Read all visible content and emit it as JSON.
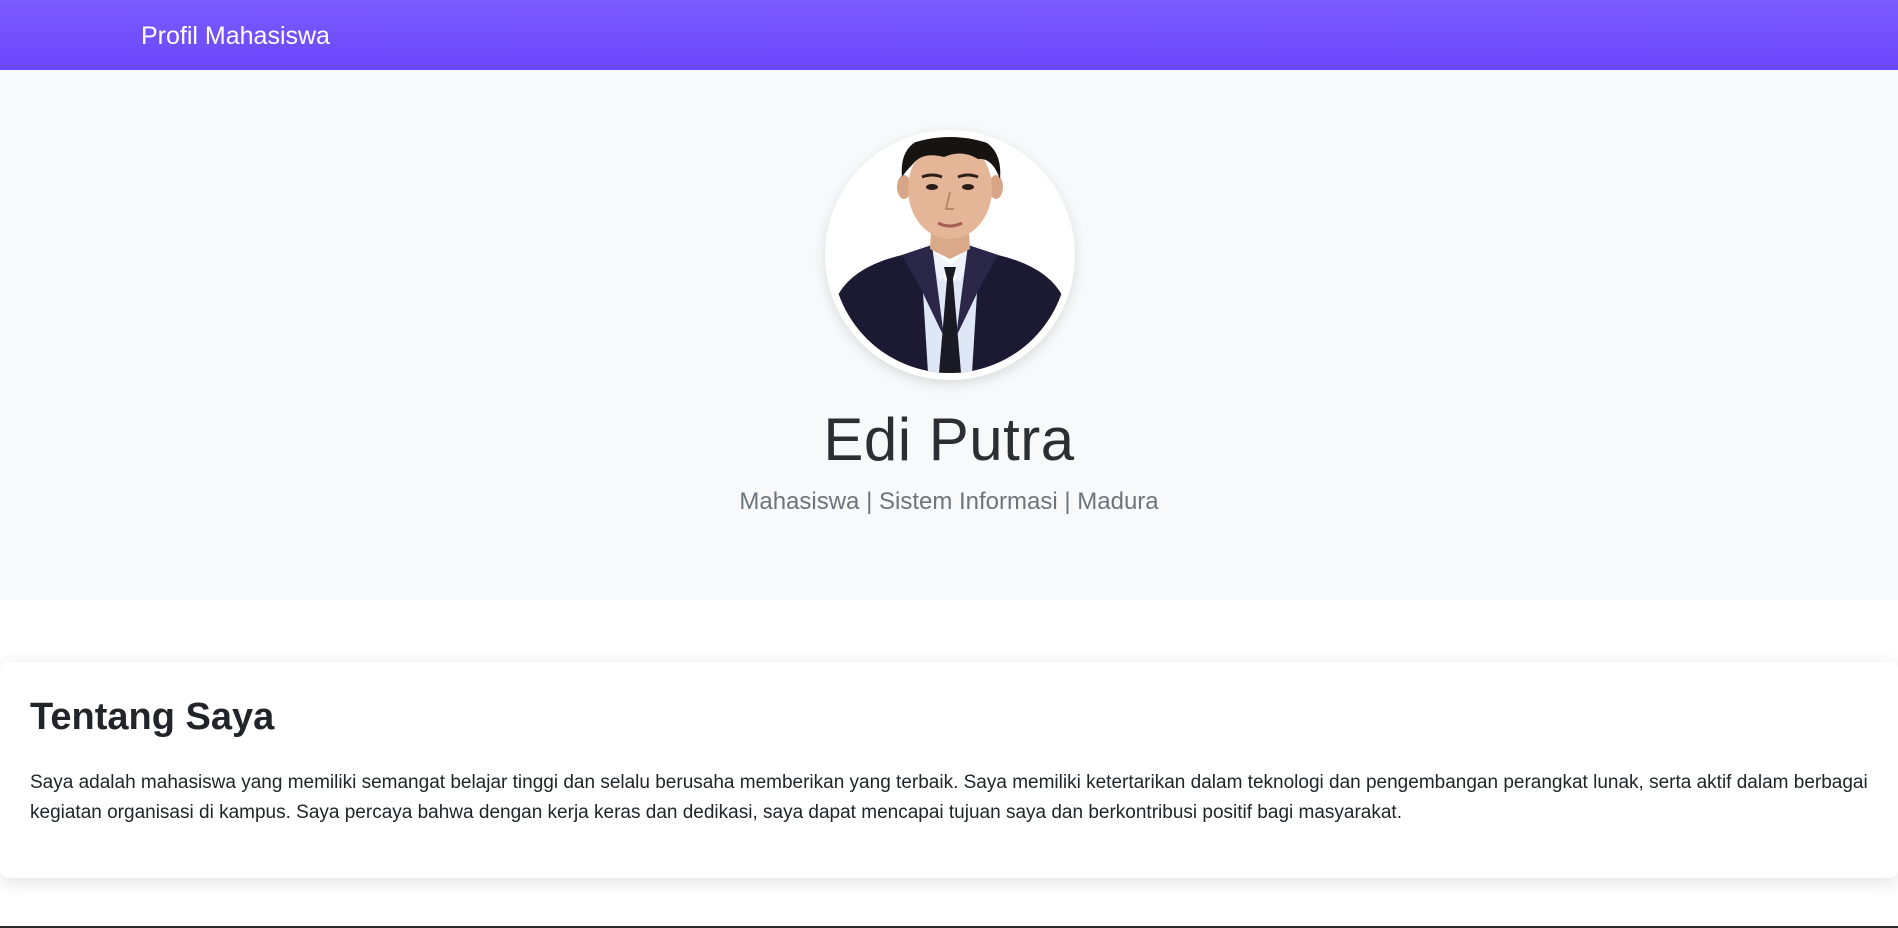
{
  "navbar": {
    "brand": "Profil Mahasiswa"
  },
  "hero": {
    "avatar_alt": "profile-photo",
    "name": "Edi Putra",
    "subtitle": "Mahasiswa | Sistem Informasi | Madura"
  },
  "about": {
    "title": "Tentang Saya",
    "text": "Saya adalah mahasiswa yang memiliki semangat belajar tinggi dan selalu berusaha memberikan yang terbaik. Saya memiliki ketertarikan dalam teknologi dan pengembangan perangkat lunak, serta aktif dalam berbagai kegiatan organisasi di kampus. Saya percaya bahwa dengan kerja keras dan dedikasi, saya dapat mencapai tujuan saya dan berkontribusi positif bagi masyarakat."
  },
  "colors": {
    "navbar": "#6a47fb",
    "hero_bg": "#f8f9fa",
    "suit": "#1c1a33",
    "shirt": "#dfe6f5"
  }
}
